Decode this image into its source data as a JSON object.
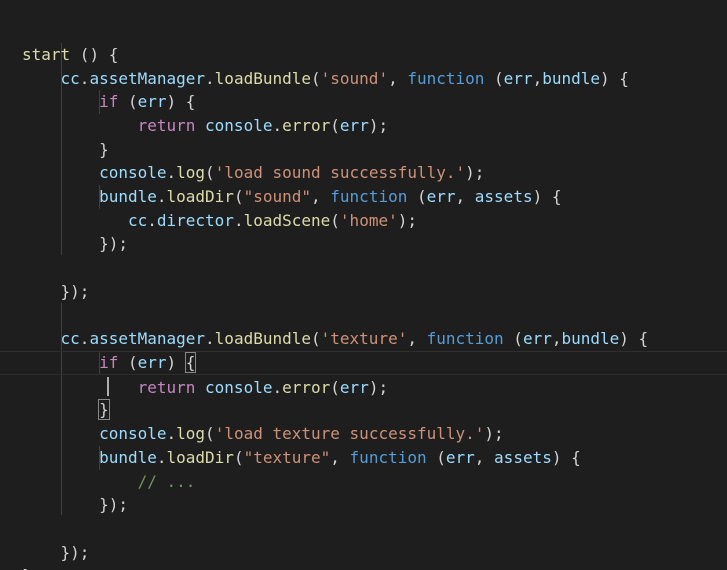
{
  "editor": {
    "background": "#1e1e1e",
    "language": "javascript",
    "theme_colors": {
      "keyword": "#569cd6",
      "control": "#c586c0",
      "function": "#dcdcaa",
      "variable": "#9cdcfe",
      "string": "#ce9178",
      "comment": "#6a9955",
      "text": "#d4d4d4"
    },
    "lines": [
      "start () {",
      "    cc.assetManager.loadBundle('sound', function (err,bundle) {",
      "        if (err) {",
      "            return console.error(err);",
      "        }",
      "        console.log('load sound successfully.');",
      "        bundle.loadDir(\"sound\", function (err, assets) {",
      "           cc.director.loadScene('home');",
      "        });",
      "",
      "    });",
      "",
      "    cc.assetManager.loadBundle('texture', function (err,bundle) {",
      "        if (err) {",
      "            return console.error(err);",
      "        }",
      "        console.log('load texture successfully.');",
      "        bundle.loadDir(\"texture\", function (err, assets) {",
      "            // ...",
      "        });",
      "",
      "    });",
      "},"
    ]
  }
}
